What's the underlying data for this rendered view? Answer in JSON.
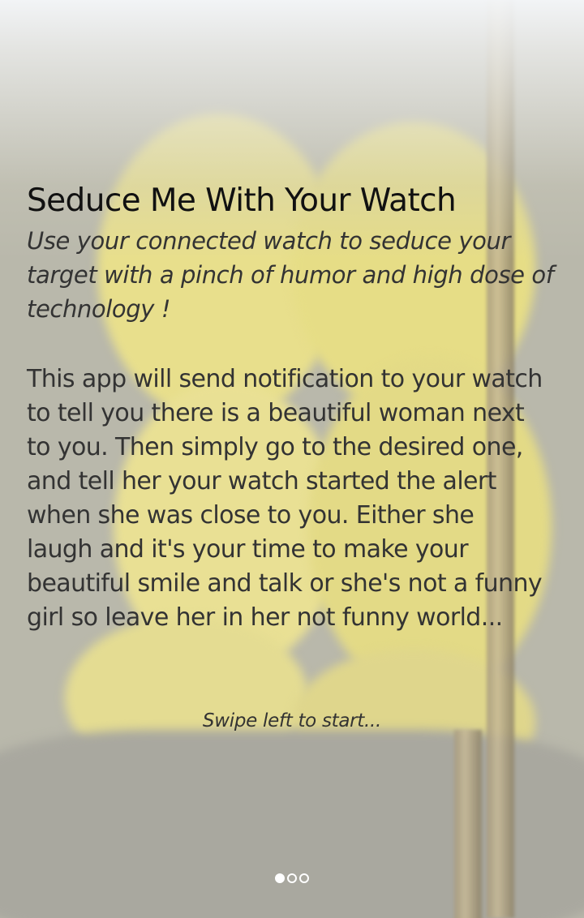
{
  "onboarding": {
    "title": "Seduce Me With Your Watch",
    "subtitle": "Use your connected watch to seduce your target with a pinch of humor and high dose of technology !",
    "body": "This app will send notification to your watch to tell you there is a beautiful woman next to you. Then simply go to the desired one, and tell her your watch started the alert when she was close to you. Either she laugh and it's your time to make your beautiful smile and talk or she's not a funny girl so leave her in her not funny world...",
    "swipe_hint": "Swipe left to start...",
    "pager": {
      "total_pages": 3,
      "current_page": 1
    }
  },
  "colors": {
    "title_text": "#111111",
    "body_text": "#333333",
    "pager_dot": "#ffffff",
    "background_yellow": "#e6dd86",
    "background_gray": "#b9b8ab"
  }
}
